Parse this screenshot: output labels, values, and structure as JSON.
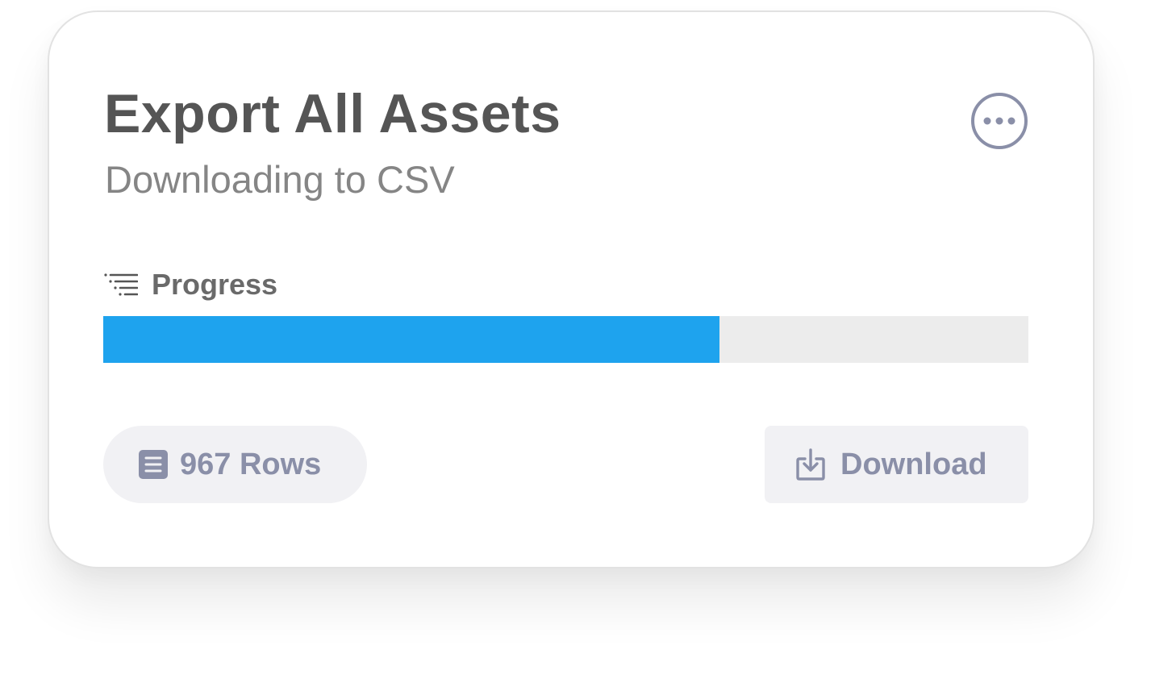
{
  "card": {
    "title": "Export All Assets",
    "subtitle": "Downloading to CSV",
    "more_icon": "ellipsis-circle-icon"
  },
  "progress": {
    "label": "Progress",
    "icon": "list-icon",
    "fraction": 0.666,
    "fill_color": "#1ea3ee",
    "track_color": "#ececec"
  },
  "rows": {
    "label": "967 Rows",
    "icon": "document-icon"
  },
  "download": {
    "label": "Download",
    "icon": "download-tray-icon"
  },
  "colors": {
    "title": "#555555",
    "subtitle": "#858585",
    "accent_muted": "#8a8fa8",
    "pill_background": "#f1f1f4"
  }
}
